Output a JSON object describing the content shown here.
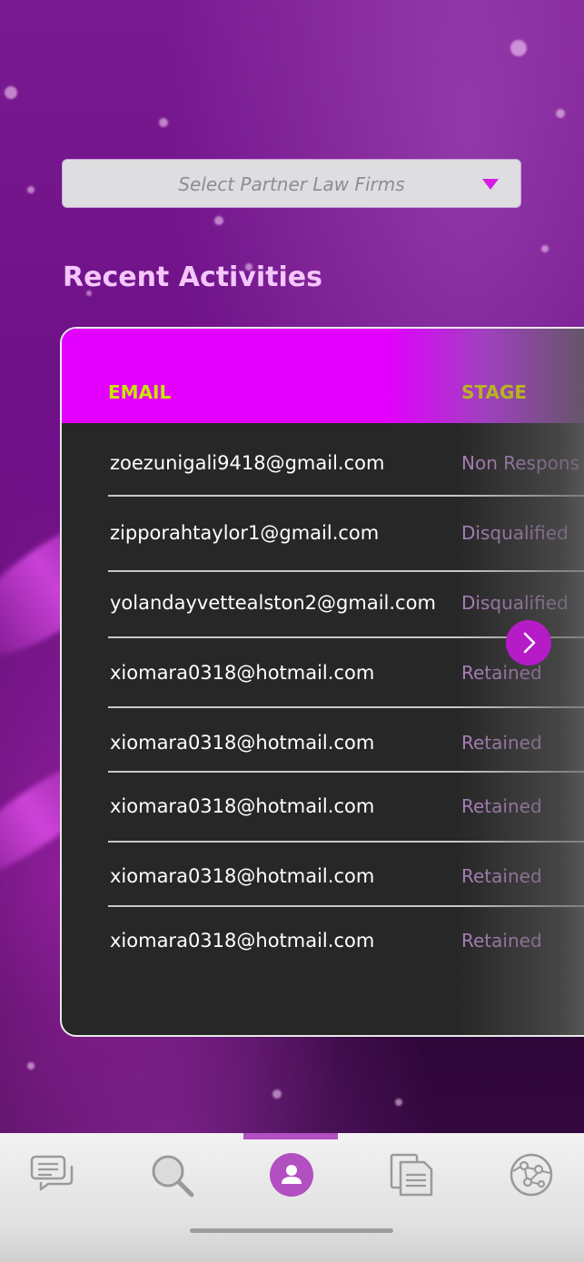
{
  "dropdown": {
    "placeholder": "Select Partner Law Firms"
  },
  "section": {
    "title": "Recent Activities"
  },
  "table": {
    "headers": {
      "email": "EMAIL",
      "stage": "STAGE"
    },
    "rows": [
      {
        "email": "zoezunigali9418@gmail.com",
        "stage": "Non Respons"
      },
      {
        "email": "zipporahtaylor1@gmail.com",
        "stage": "Disqualified"
      },
      {
        "email": "yolandayvettealston2@gmail.com",
        "stage": "Disqualified"
      },
      {
        "email": "xiomara0318@hotmail.com",
        "stage": "Retained"
      },
      {
        "email": "xiomara0318@hotmail.com",
        "stage": "Retained"
      },
      {
        "email": "xiomara0318@hotmail.com",
        "stage": "Retained"
      },
      {
        "email": "xiomara0318@hotmail.com",
        "stage": "Retained"
      },
      {
        "email": "xiomara0318@hotmail.com",
        "stage": "Retained"
      }
    ]
  },
  "tabbar": {
    "tabs": [
      {
        "icon": "chat-icon",
        "active": false
      },
      {
        "icon": "search-icon",
        "active": false
      },
      {
        "icon": "profile-icon",
        "active": true
      },
      {
        "icon": "documents-icon",
        "active": false
      },
      {
        "icon": "network-icon",
        "active": false
      }
    ]
  },
  "colors": {
    "accent": "#e300ff",
    "header_text": "#c9e500",
    "stage_text": "#a97fb8",
    "active_tab": "#b24fc1"
  }
}
